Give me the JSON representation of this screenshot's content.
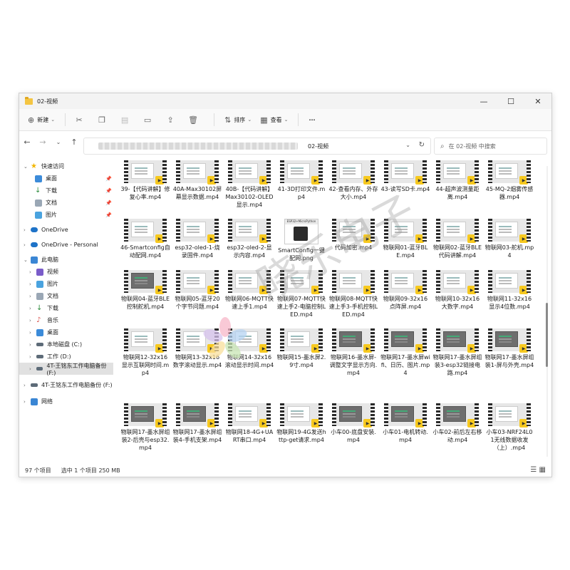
{
  "window": {
    "title": "02-视频",
    "controls": [
      "—",
      "☐",
      "✕"
    ]
  },
  "toolbar": {
    "new_label": "新建",
    "sort_label": "排序",
    "view_label": "查看",
    "more_label": "···"
  },
  "address": {
    "current_folder": "02-视频"
  },
  "search": {
    "placeholder": "在 02-视频 中搜索"
  },
  "sidebar": {
    "items": [
      {
        "label": "快速访问"
      },
      {
        "label": "桌面"
      },
      {
        "label": "下载"
      },
      {
        "label": "文档"
      },
      {
        "label": "图片"
      },
      {
        "label": "OneDrive"
      },
      {
        "label": "OneDrive - Personal"
      },
      {
        "label": "此电脑"
      },
      {
        "label": "视频"
      },
      {
        "label": "图片"
      },
      {
        "label": "文档"
      },
      {
        "label": "下载"
      },
      {
        "label": "音乐"
      },
      {
        "label": "桌面"
      },
      {
        "label": "本地磁盘 (C:)"
      },
      {
        "label": "工作 (D:)"
      },
      {
        "label": "4T-王铭东工作电脑备份 (F:)"
      },
      {
        "label": "4T-王铭东工作电脑备份 (F:)"
      },
      {
        "label": "网络"
      }
    ]
  },
  "files": [
    "39-【代码讲解】修复心率.mp4",
    "40A-Max30102屏幕显示数据.mp4",
    "40B-【代码讲解】Max30102-OLED显示.mp4",
    "41-3D打印文件.mp4",
    "42-查看内存、外存大小.mp4",
    "43-读写SD卡.mp4",
    "44-超声波测量距离.mp4",
    "45-MQ-2烟雾传感器.mp4",
    "46-Smartconfig自动配网.mp4",
    "esp32-oled-1-烧录固件.mp4",
    "esp32-oled-2-显示内容.mp4",
    "SmartConfig一键配网.png",
    "代码加密.mp4",
    "物联网01-蓝牙BLE.mp4",
    "物联网02-蓝牙BLE代码讲解.mp4",
    "物联网03-舵机.mp4",
    "物联网04-蓝牙BLE控制舵机.mp4",
    "物联网05-蓝牙20个字节问题.mp4",
    "物联网06-MQTT快速上手1.mp4",
    "物联网07-MQTT快速上手2-电脑控制LED.mp4",
    "物联网08-MQTT快速上手3-手机控制LED.mp4",
    "物联网09-32x16点阵屏.mp4",
    "物联网10-32x16大数字.mp4",
    "物联网11-32x16显示4位数.mp4",
    "物联网12-32x16显示互联网时间.mp4",
    "物联网13-32x16数字滚动显示.mp4",
    "物联网14-32x16滚动显示时间.mp4",
    "物联网15-墨水屏2.9寸.mp4",
    "物联网16-墨水屏-调整文字显示方向.mp4",
    "物联网17-墨水屏wifi、日历、图片.mp4",
    "物联网17-墨水屏组装3-esp32链接电路.mp4",
    "物联网17-墨水屏组装1-屏与外壳.mp4",
    "物联网17-墨水屏组装2-后壳与esp32.mp4",
    "物联网17-墨水屏组装4-手机支架.mp4",
    "物联网18-4G+UART串口.mp4",
    "物联网19-4G发送http-get请求.mp4",
    "小车00-底盘安装.mp4",
    "小车01-电机转动.mp4",
    "小车02-前后左右移动.mp4",
    "小车03-NRF24L01无线数据收发（上）.mp4"
  ],
  "file_preview": {
    "image_header": "ESP32+MicroPython"
  },
  "status": {
    "count": "97 个项目",
    "selected": "选中 1 个项目  250 MB"
  },
  "watermark": {
    "text": "晓乐电子"
  }
}
